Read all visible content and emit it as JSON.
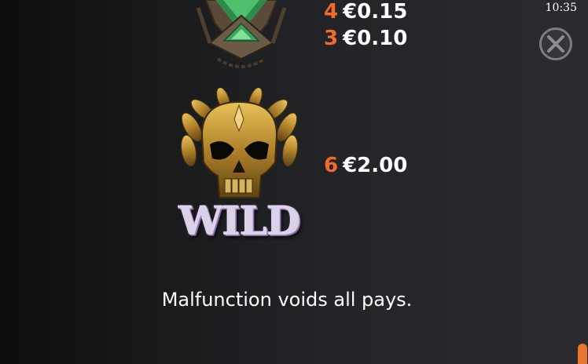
{
  "status_bar": {
    "time": "10:35"
  },
  "paytable": {
    "symbols": [
      {
        "icon": "green-crystal-shield-icon",
        "pays": [
          {
            "count": "4",
            "value": "€0.15"
          },
          {
            "count": "3",
            "value": "€0.10"
          }
        ]
      },
      {
        "icon": "golden-skull-wild-icon",
        "logo_text": "WILD",
        "pays": [
          {
            "count": "6",
            "value": "€2.00"
          }
        ]
      }
    ],
    "footer": "Malfunction voids all pays."
  },
  "colors": {
    "count_accent": "#f26b2a",
    "scroll_thumb": "#e8742d"
  }
}
